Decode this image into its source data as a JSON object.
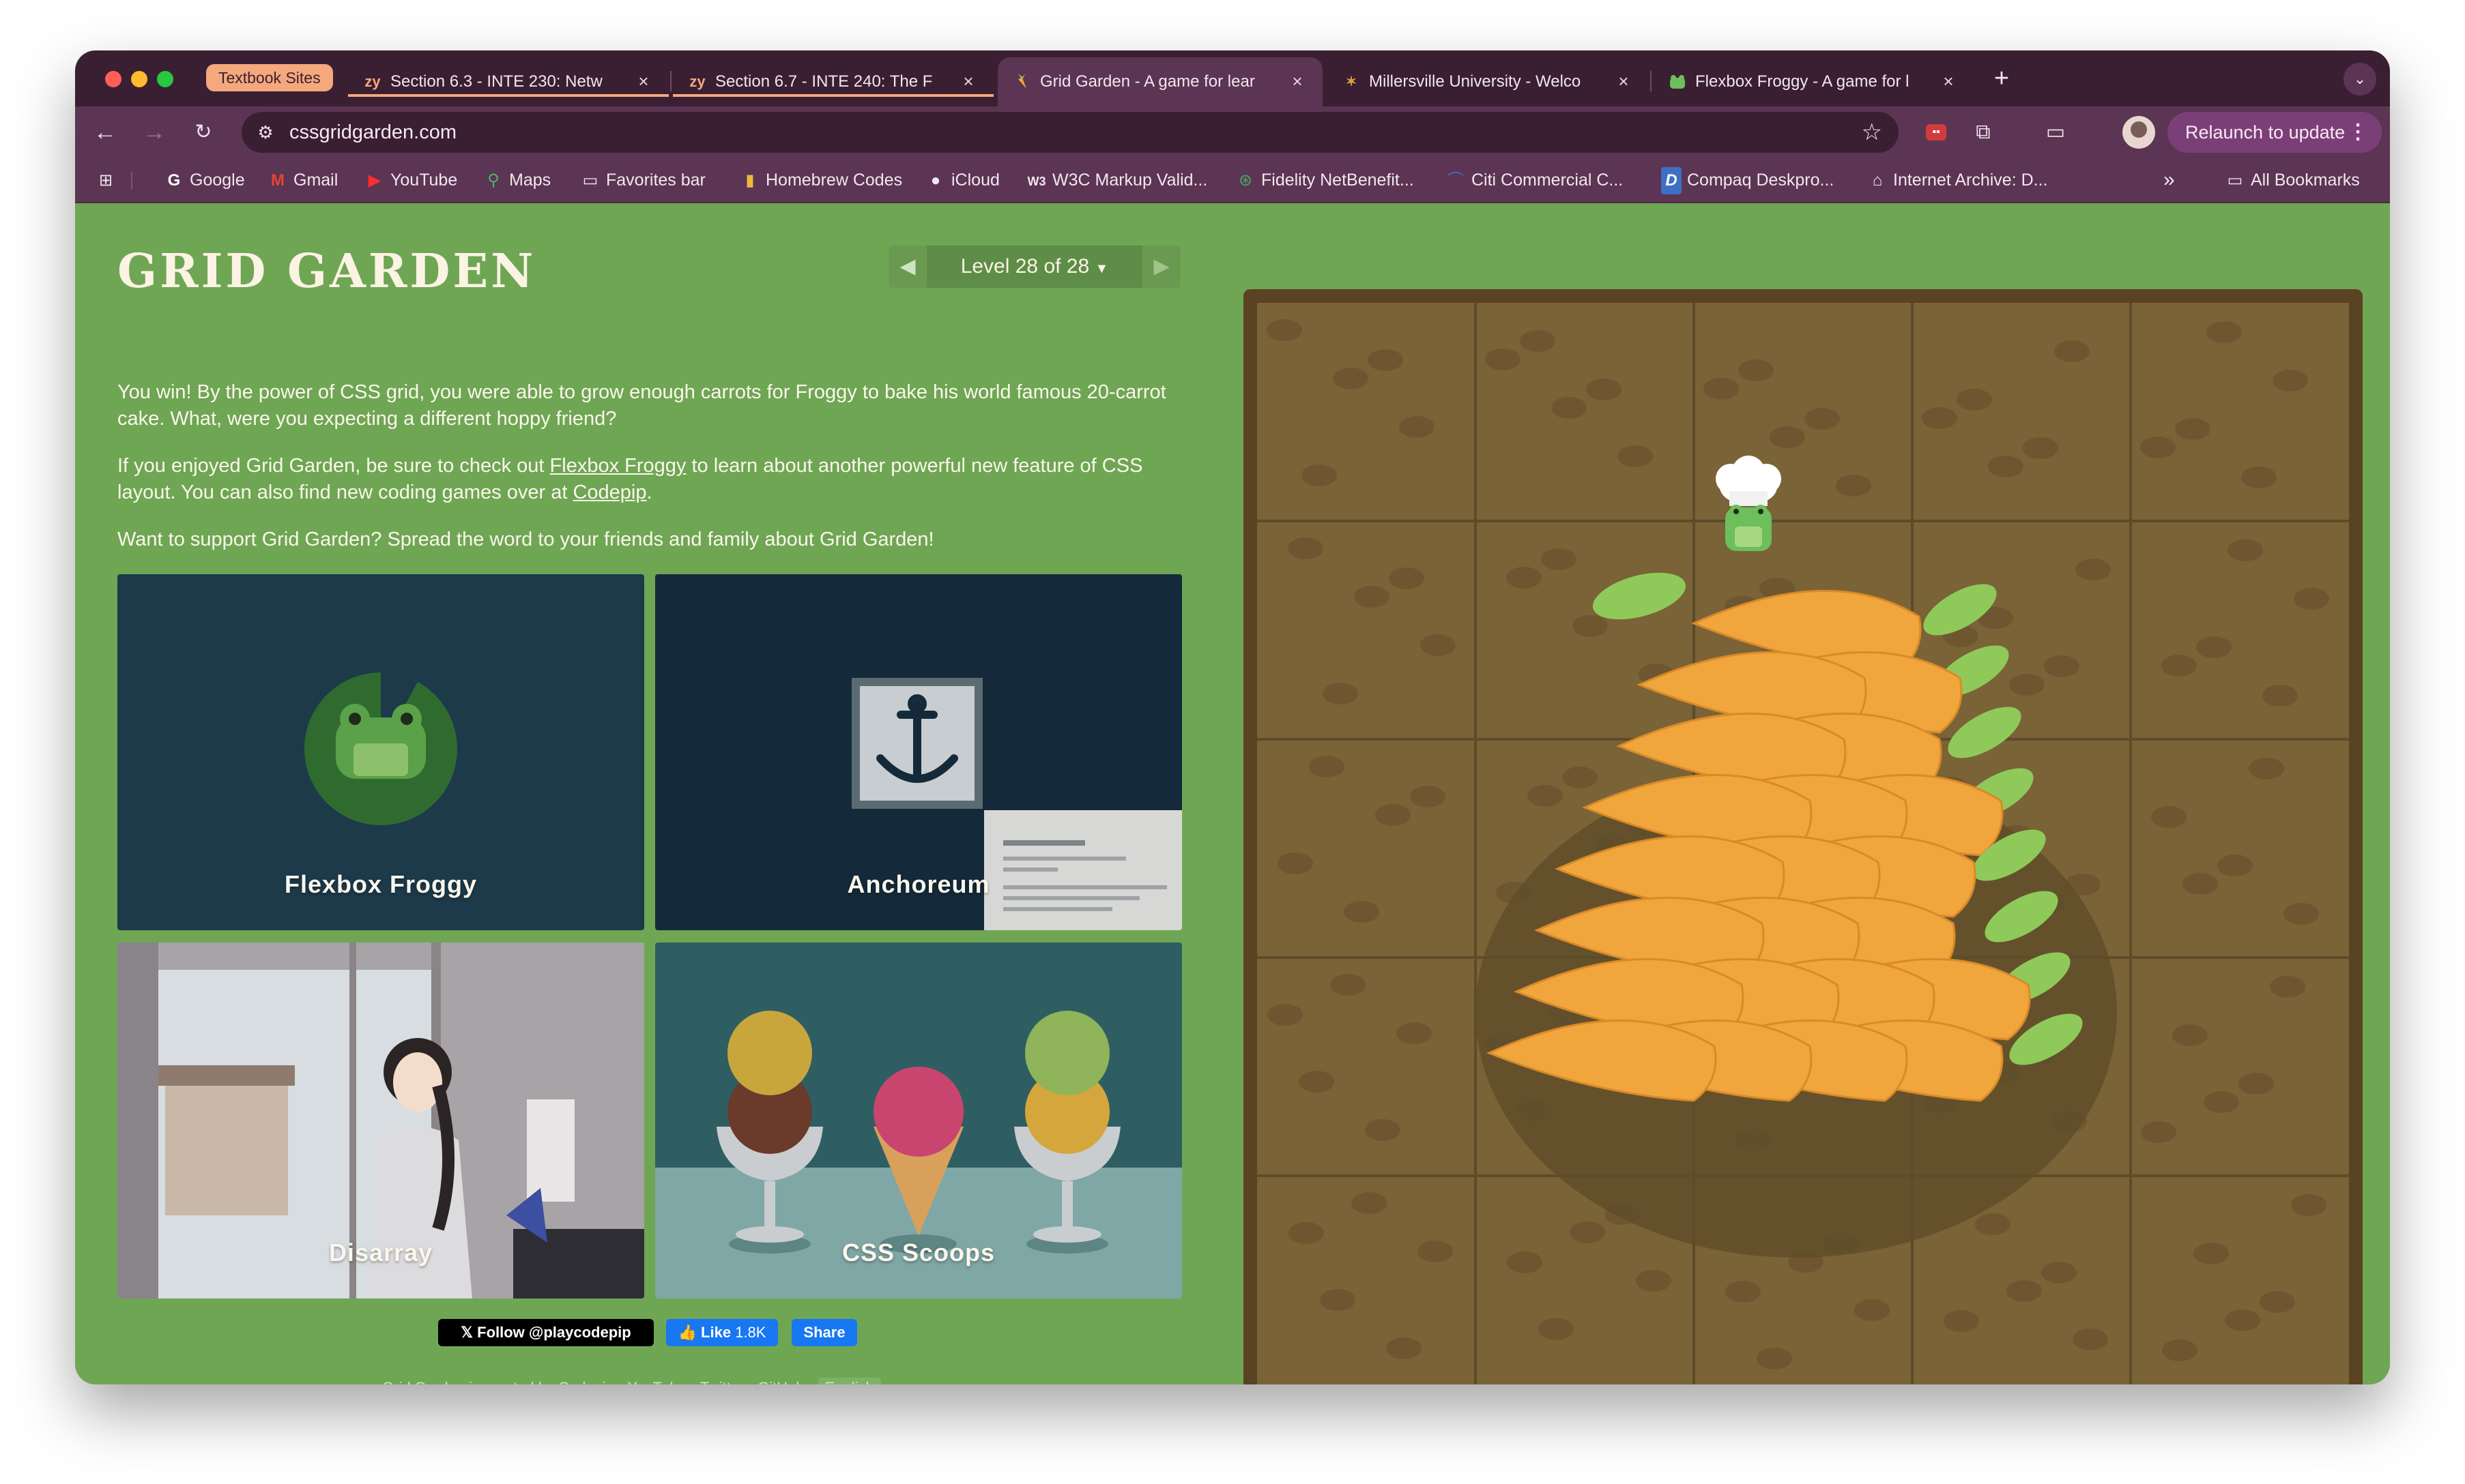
{
  "browser": {
    "tab_group": "Textbook Sites",
    "tabs": [
      {
        "favicon": "zy",
        "title": "Section 6.3 - INTE 230: Netw"
      },
      {
        "favicon": "zy",
        "title": "Section 6.7 - INTE 240: The F"
      },
      {
        "favicon": "carrot-icon",
        "title": "Grid Garden - A game for lear"
      },
      {
        "favicon": "millersville-icon",
        "title": "Millersville University - Welco"
      },
      {
        "favicon": "frog-icon",
        "title": "Flexbox Froggy - A game for l"
      }
    ],
    "url": "cssgridgarden.com",
    "relaunch_label": "Relaunch to update",
    "bookmarks": [
      "Google",
      "Gmail",
      "YouTube",
      "Maps",
      "Favorites bar",
      "Homebrew Codes",
      "iCloud",
      "W3C Markup Valid...",
      "Fidelity NetBenefit...",
      "Citi Commercial C...",
      "Compaq Deskpro...",
      "Internet Archive: D..."
    ],
    "all_bookmarks": "All Bookmarks",
    "more_bookmarks": "»"
  },
  "game": {
    "title": "GRID GARDEN",
    "level_label": "Level 28 of 28",
    "win_text": "You win! By the power of CSS grid, you were able to grow enough carrots for Froggy to bake his world famous 20-carrot cake. What, were you expecting a different hoppy friend?",
    "enjoy_prefix": "If you enjoyed Grid Garden, be sure to check out ",
    "link_froggy": "Flexbox Froggy",
    "enjoy_middle": " to learn about another powerful new feature of CSS layout. You can also find new coding games over at ",
    "link_codepip": "Codepip",
    "enjoy_suffix": ".",
    "support_text": "Want to support Grid Garden? Spread the word to your friends and family about Grid Garden!",
    "cards": [
      "Flexbox Froggy",
      "Anchoreum",
      "Disarray",
      "CSS Scoops"
    ],
    "follow_label": "Follow @playcodepip",
    "like_label": "Like",
    "like_count": "1.8K",
    "share_label": "Share",
    "footer": "Grid Garden is created by Codepip • YouTube • Twitter • GitHub •",
    "language": "English"
  },
  "colors": {
    "page_bg": "#6fa654",
    "board_soil": "#7a6336",
    "carrot": "#f0a63c",
    "leaf": "#8fc95a"
  }
}
